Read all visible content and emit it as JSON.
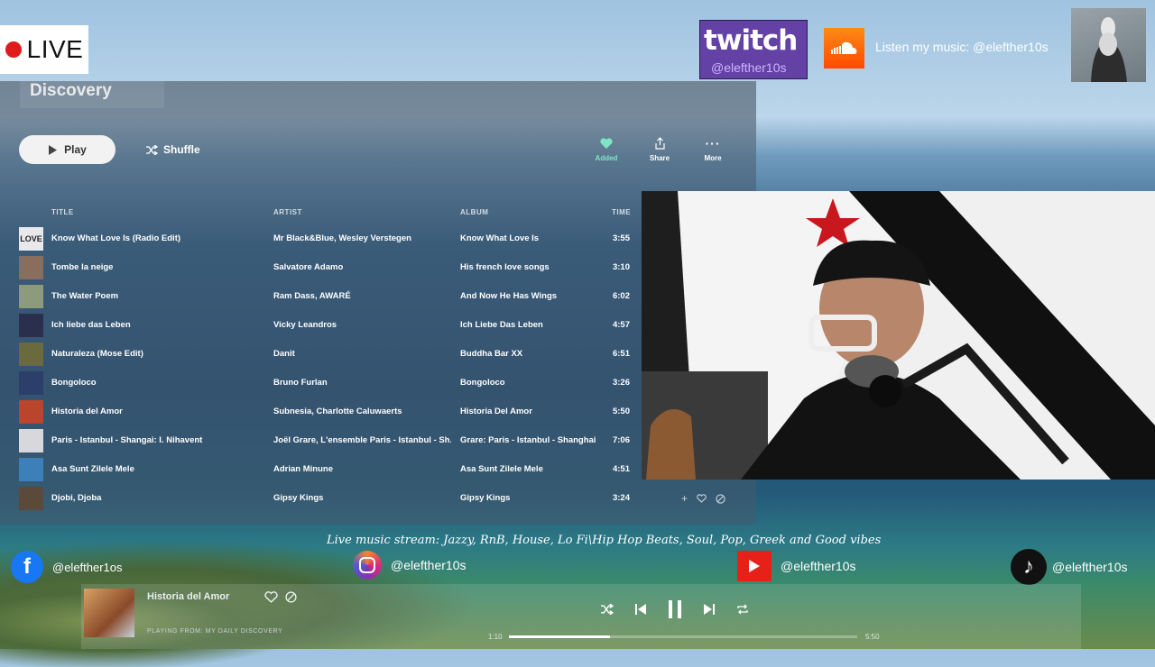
{
  "overlay": {
    "live_label": "LIVE",
    "twitch_word": "twitch",
    "twitch_handle": "@elefther10s",
    "soundcloud_text": "Listen my music: @elefther10s",
    "stream_tagline": "Live music stream: Jazzy, RnB, House, Lo Fi\\Hip Hop Beats, Soul, Pop, Greek and Good vibes",
    "facebook_handle": "@elefther1os",
    "instagram_handle": "@elefther10s",
    "youtube_handle": "@elefther10s",
    "tiktok_handle": "@elefther10s"
  },
  "playlist": {
    "title": "Discovery",
    "play_label": "Play",
    "shuffle_label": "Shuffle",
    "actions": {
      "added": "Added",
      "share": "Share",
      "more": "More"
    },
    "columns": {
      "title": "TITLE",
      "artist": "ARTIST",
      "album": "ALBUM",
      "time": "TIME"
    },
    "tracks": [
      {
        "title": "Know What Love Is (Radio Edit)",
        "artist": "Mr Black&Blue, Wesley Verstegen",
        "album": "Know What Love Is",
        "time": "3:55",
        "thumb_color": "#e9e9ec",
        "thumb_text": "LOVE"
      },
      {
        "title": "Tombe la neige",
        "artist": "Salvatore Adamo",
        "album": "His french love songs",
        "time": "3:10",
        "thumb_color": "#8a6d5c"
      },
      {
        "title": "The Water Poem",
        "artist": "Ram Dass, AWARÉ",
        "album": "And Now He Has Wings",
        "time": "6:02",
        "thumb_color": "#8e9a7c"
      },
      {
        "title": "Ich liebe das Leben",
        "artist": "Vicky Leandros",
        "album": "Ich Liebe Das Leben",
        "time": "4:57",
        "thumb_color": "#2a2f4e"
      },
      {
        "title": "Naturaleza (Mose Edit)",
        "artist": "Danit",
        "album": "Buddha Bar XX",
        "time": "6:51",
        "thumb_color": "#6b6a3d"
      },
      {
        "title": "Bongoloco",
        "artist": "Bruno Furlan",
        "album": "Bongoloco",
        "time": "3:26",
        "thumb_color": "#2c3f6a"
      },
      {
        "title": "Historia del Amor",
        "artist": "Subnesia, Charlotte Caluwaerts",
        "album": "Historia Del Amor",
        "time": "5:50",
        "thumb_color": "#b8452c"
      },
      {
        "title": "Paris - Istanbul - Shangai: I. Nihavent",
        "artist": "Joël Grare, L'ensemble Paris - Istanbul - Sh...",
        "album": "Grare: Paris - Istanbul - Shanghai",
        "time": "7:06",
        "thumb_color": "#d8d8dc"
      },
      {
        "title": "Asa Sunt Zilele Mele",
        "artist": "Adrian Minune",
        "album": "Asa Sunt Zilele Mele",
        "time": "4:51",
        "thumb_color": "#3d7fb8"
      },
      {
        "title": "Djobi, Djoba",
        "artist": "Gipsy Kings",
        "album": "Gipsy Kings",
        "time": "3:24",
        "thumb_color": "#5b4a3a"
      }
    ]
  },
  "player": {
    "now_title": "Historia del Amor",
    "playing_from": "PLAYING FROM: MY DAILY DISCOVERY",
    "elapsed": "1:10",
    "duration": "5:50",
    "progress_fraction": 0.29
  },
  "colors": {
    "accent_added": "#7ee6c6",
    "twitch": "#6441a5",
    "soundcloud": "#ff5500",
    "facebook": "#1877f2",
    "youtube": "#e62117",
    "live_dot": "#e01b1b"
  }
}
